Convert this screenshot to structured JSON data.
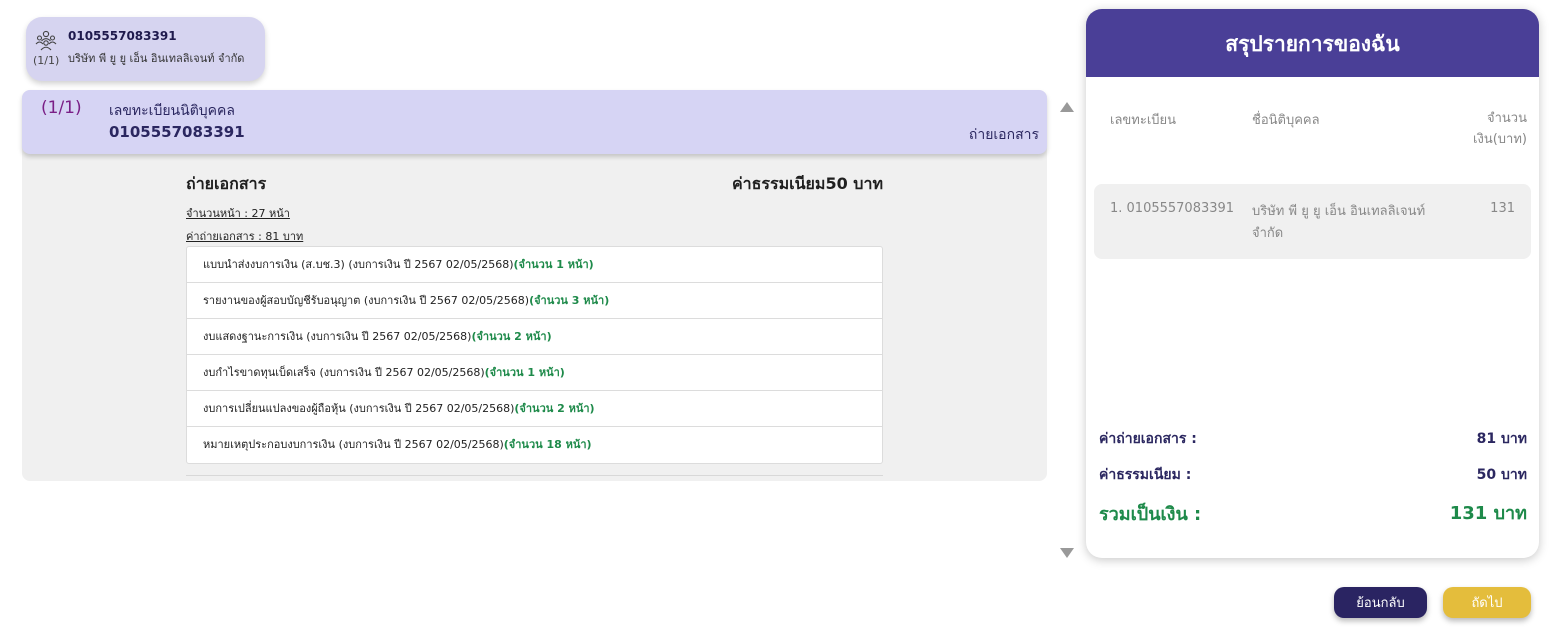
{
  "company_chip": {
    "icon": "people-group-icon",
    "count": "(1/1)",
    "registration_id": "0105557083391",
    "company_name": "บริษัท พี ยู ยู เอ็น อินเทลลิเจนท์ จำกัด"
  },
  "panel": {
    "count": "(1/1)",
    "label": "เลขทะเบียนนิติบุคคล",
    "registration_id": "0105557083391",
    "service": "ถ่ายเอกสาร",
    "section_title": "ถ่ายเอกสาร",
    "fee_text": "ค่าธรรมเนียม50 บาท",
    "page_count_text": "จำนวนหน้า : 27 หน้า",
    "copy_cost_text": "ค่าถ่ายเอกสาร : 81 บาท",
    "documents": [
      {
        "name": "แบบนำส่งงบการเงิน (ส.บช.3) (งบการเงิน ปี 2567 02/05/2568)",
        "pages": "(จำนวน 1 หน้า)"
      },
      {
        "name": "รายงานของผู้สอบบัญชีรับอนุญาต (งบการเงิน ปี 2567 02/05/2568)",
        "pages": "(จำนวน 3 หน้า)"
      },
      {
        "name": "งบแสดงฐานะการเงิน (งบการเงิน ปี 2567 02/05/2568)",
        "pages": "(จำนวน 2 หน้า)"
      },
      {
        "name": "งบกำไรขาดทุนเบ็ดเสร็จ (งบการเงิน ปี 2567 02/05/2568)",
        "pages": "(จำนวน 1 หน้า)"
      },
      {
        "name": "งบการเปลี่ยนแปลงของผู้ถือหุ้น (งบการเงิน ปี 2567 02/05/2568)",
        "pages": "(จำนวน 2 หน้า)"
      },
      {
        "name": "หมายเหตุประกอบงบการเงิน (งบการเงิน ปี 2567 02/05/2568)",
        "pages": "(จำนวน 18 หน้า)"
      }
    ]
  },
  "scroll": {
    "up_icon": "triangle-up-icon",
    "down_icon": "triangle-down-icon"
  },
  "summary": {
    "title": "สรุปรายการของฉัน",
    "col_registration": "เลขทะเบียน",
    "col_name": "ชื่อนิติบุคคล",
    "col_amount_line1": "จำนวน",
    "col_amount_line2": "เงิน(บาท)",
    "rows": [
      {
        "registration": "1. 0105557083391",
        "name": "บริษัท พี ยู ยู เอ็น อินเทลลิเจนท์ จำกัด",
        "amount": "131"
      }
    ],
    "copy_cost_label": "ค่าถ่ายเอกสาร :",
    "copy_cost_value": "81 บาท",
    "fee_label": "ค่าธรรมเนียม :",
    "fee_value": "50 บาท",
    "total_label": "รวมเป็นเงิน :",
    "total_value": "131 บาท"
  },
  "buttons": {
    "back": "ย้อนกลับ",
    "next": "ถัดไป"
  },
  "colors": {
    "primary": "#4a3f97",
    "accent_green": "#1e8a4a",
    "next_button": "#e4bd3c",
    "back_button": "#2a2462",
    "header_lavender": "#d6d4f4"
  }
}
